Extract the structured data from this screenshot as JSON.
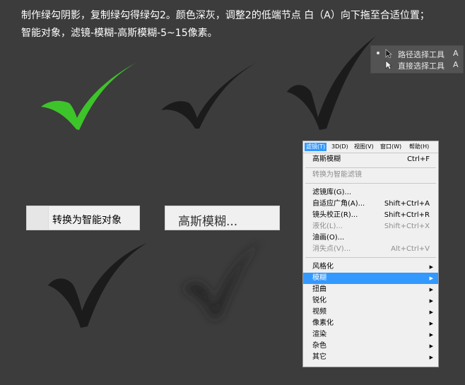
{
  "instructions": {
    "line1": "制作绿勾阴影，复制绿勾得绿勾2。颜色深灰，调整2的低端节点 白（A）向下拖至合适位置；",
    "line2": "智能对象，滤镜-模糊-高斯模糊-5~15像素。"
  },
  "colors": {
    "background": "#3c3c3c",
    "green_check": "#3dc42a",
    "dark_check": "#1b1b1b",
    "menu_highlight": "#3399ff"
  },
  "tool_popup": {
    "items": [
      {
        "label": "路径选择工具",
        "key": "A",
        "icon": "path-selection-cursor-icon"
      },
      {
        "label": "直接选择工具",
        "key": "A",
        "icon": "direct-selection-cursor-icon"
      }
    ]
  },
  "buttons": {
    "convert_label": "转换为智能对象",
    "gaussian_label": "高斯模糊..."
  },
  "menubar": [
    {
      "label": "滤镜(T)",
      "active": true
    },
    {
      "label": "3D(D)"
    },
    {
      "label": "视图(V)"
    },
    {
      "label": "窗口(W)"
    },
    {
      "label": "帮助(H)"
    }
  ],
  "menu": {
    "gaussian": {
      "label": "高斯模糊",
      "shortcut": "Ctrl+F"
    },
    "convert_smart": {
      "label": "转换为智能滤镜"
    },
    "gallery": {
      "label": "滤镜库(G)..."
    },
    "adaptive_wide": {
      "label": "自适应广角(A)...",
      "shortcut": "Shift+Ctrl+A"
    },
    "lens_correction": {
      "label": "镜头校正(R)...",
      "shortcut": "Shift+Ctrl+R"
    },
    "liquify": {
      "label": "液化(L)...",
      "shortcut": "Shift+Ctrl+X"
    },
    "oil_paint": {
      "label": "油画(O)..."
    },
    "vanishing_point": {
      "label": "消失点(V)...",
      "shortcut": "Alt+Ctrl+V"
    },
    "submenus": [
      "风格化",
      "模糊",
      "扭曲",
      "锐化",
      "视频",
      "像素化",
      "渲染",
      "杂色",
      "其它"
    ]
  }
}
